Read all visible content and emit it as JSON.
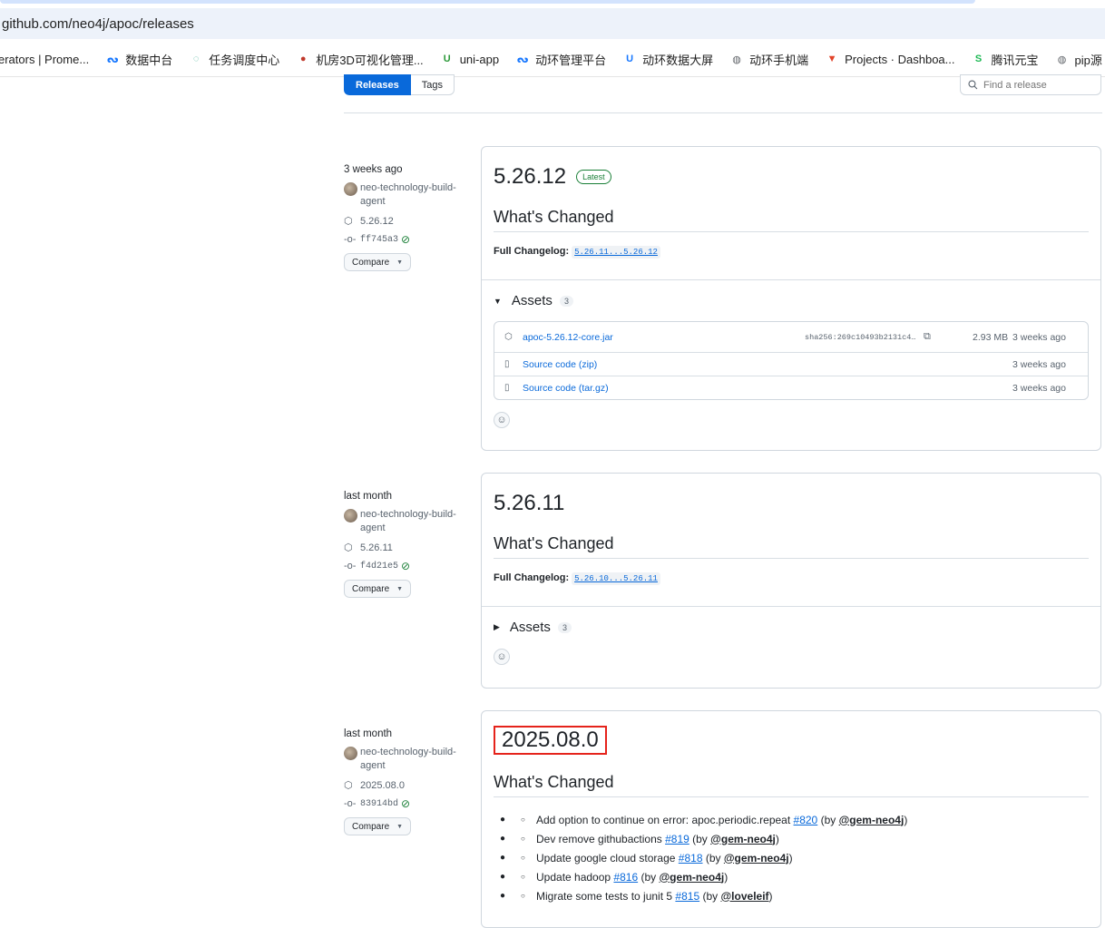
{
  "browser": {
    "url": "github.com/neo4j/apoc/releases",
    "bookmarks": [
      {
        "label": "erators | Prome...",
        "icon": "grafana-icon",
        "color": "#f46800"
      },
      {
        "label": "数据中台",
        "icon": "dataphin-icon",
        "color": "#1677ff"
      },
      {
        "label": "任务调度中心",
        "icon": "scheduler-icon",
        "color": "#49b49a"
      },
      {
        "label": "机房3D可视化管理...",
        "icon": "badge-icon",
        "color": "#c0392b"
      },
      {
        "label": "uni-app",
        "icon": "uniapp-icon",
        "color": "#2b9939"
      },
      {
        "label": "动环管理平台",
        "icon": "dataphin-icon",
        "color": "#1677ff"
      },
      {
        "label": "动环数据大屏",
        "icon": "uniapp-icon",
        "color": "#1677ff"
      },
      {
        "label": "动环手机端",
        "icon": "globe-icon",
        "color": "#5f6368"
      },
      {
        "label": "Projects · Dashboa...",
        "icon": "gitlab-icon",
        "color": "#e24329"
      },
      {
        "label": "腾讯元宝",
        "icon": "yuanbao-icon",
        "color": "#1db954"
      },
      {
        "label": "pip源",
        "icon": "globe-icon",
        "color": "#5f6368"
      }
    ]
  },
  "header": {
    "tab_releases": "Releases",
    "tab_tags": "Tags",
    "search_placeholder": "Find a release"
  },
  "releases": [
    {
      "when": "3 weeks ago",
      "author": "neo-technology-build-agent",
      "tag": "5.26.12",
      "commit": "ff745a3",
      "compare": "Compare",
      "version": "5.26.12",
      "latest_badge": "Latest",
      "whats_changed": "What's Changed",
      "full_changelog_label": "Full Changelog:",
      "full_changelog_link": "5.26.11...5.26.12",
      "assets_label": "Assets",
      "assets_count": "3",
      "assets": [
        {
          "name": "apoc-5.26.12-core.jar",
          "sub": "",
          "sha": "sha256:269c10493b2131c4…",
          "size": "2.93 MB",
          "age": "3 weeks ago"
        },
        {
          "name": "Source code",
          "sub": "(zip)",
          "sha": "",
          "size": "",
          "age": "3 weeks ago"
        },
        {
          "name": "Source code",
          "sub": "(tar.gz)",
          "sha": "",
          "size": "",
          "age": "3 weeks ago"
        }
      ]
    },
    {
      "when": "last month",
      "author": "neo-technology-build-agent",
      "tag": "5.26.11",
      "commit": "f4d21e5",
      "compare": "Compare",
      "version": "5.26.11",
      "whats_changed": "What's Changed",
      "full_changelog_label": "Full Changelog:",
      "full_changelog_link": "5.26.10...5.26.11",
      "assets_label": "Assets",
      "assets_count": "3"
    },
    {
      "when": "last month",
      "author": "neo-technology-build-agent",
      "tag": "2025.08.0",
      "commit": "83914bd",
      "compare": "Compare",
      "version": "2025.08.0",
      "whats_changed": "What's Changed",
      "changes": [
        {
          "text": "Add option to continue on error: apoc.periodic.repeat",
          "pr": "#820",
          "by": "(by",
          "user": "@gem-neo4j",
          "end": ")"
        },
        {
          "text": "Dev remove githubactions",
          "pr": "#819",
          "by": "(by",
          "user": "@gem-neo4j",
          "end": ")"
        },
        {
          "text": "Update google cloud storage",
          "pr": "#818",
          "by": "(by",
          "user": "@gem-neo4j",
          "end": ")"
        },
        {
          "text": "Update hadoop",
          "pr": "#816",
          "by": "(by",
          "user": "@gem-neo4j",
          "end": ")"
        },
        {
          "text": "Migrate some tests to junit 5",
          "pr": "#815",
          "by": "(by",
          "user": "@loveleif",
          "end": ")"
        }
      ]
    }
  ],
  "colors": {
    "accent": "#0969da",
    "success": "#1a7f37",
    "highlight_box": "#e5231b"
  }
}
